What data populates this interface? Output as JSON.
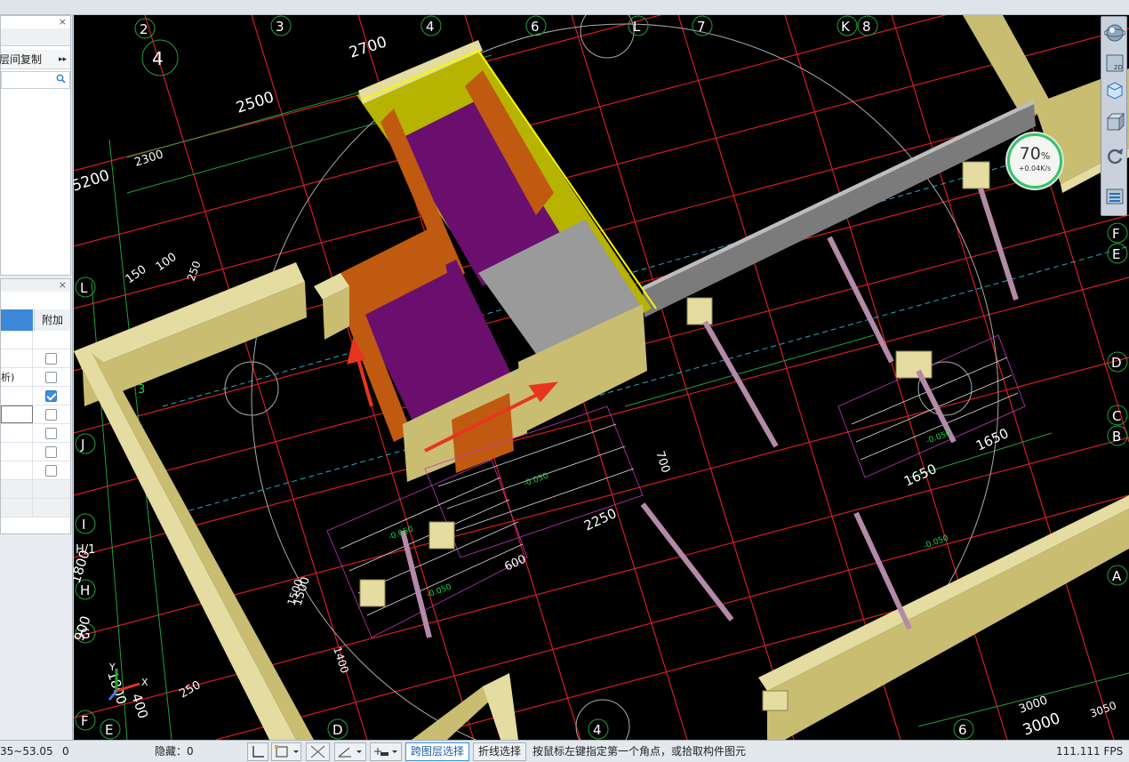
{
  "left_panel_top": {
    "close_label": "×",
    "toolbar_label": "层间复制",
    "more_label": "▸▸"
  },
  "left_panel_bottom": {
    "close_label": "×",
    "column_header": "附加",
    "rows": [
      {
        "label": "",
        "checked": false
      },
      {
        "label": "析)",
        "checked": false
      },
      {
        "label": "",
        "checked": true
      },
      {
        "label": "",
        "checked": false
      },
      {
        "label": "",
        "checked": false
      },
      {
        "label": "",
        "checked": false
      },
      {
        "label": "",
        "checked": false
      }
    ]
  },
  "speed_badge": {
    "percent": "70",
    "percent_unit": "%",
    "rate": "+0.04K/s"
  },
  "view_toolbar": {
    "icons": [
      "sphere-view-icon",
      "2d-view-icon",
      "3d-cube-icon",
      "box-view-icon",
      "rotate-icon",
      "layers-icon"
    ],
    "label_2d": "2D"
  },
  "cad": {
    "grid_labels": [
      {
        "t": "2",
        "kind": "circle"
      },
      {
        "t": "3",
        "kind": "circle"
      },
      {
        "t": "4",
        "kind": "circle"
      },
      {
        "t": "6",
        "kind": "circle"
      },
      {
        "t": "L",
        "kind": "circle"
      },
      {
        "t": "7",
        "kind": "circle"
      },
      {
        "t": "K",
        "kind": "circle"
      },
      {
        "t": "8",
        "kind": "circle"
      },
      {
        "t": "4",
        "kind": "circle"
      },
      {
        "t": "L",
        "kind": "circle"
      },
      {
        "t": "J",
        "kind": "circle"
      },
      {
        "t": "I",
        "kind": "circle"
      },
      {
        "t": "H/1",
        "kind": "plain"
      },
      {
        "t": "H",
        "kind": "circle"
      },
      {
        "t": "G",
        "kind": "circle"
      },
      {
        "t": "F",
        "kind": "circle"
      },
      {
        "t": "E",
        "kind": "circle"
      },
      {
        "t": "D",
        "kind": "circle"
      },
      {
        "t": "4",
        "kind": "circle"
      },
      {
        "t": "6",
        "kind": "circle"
      },
      {
        "t": "F",
        "kind": "circle"
      },
      {
        "t": "E",
        "kind": "circle"
      },
      {
        "t": "D",
        "kind": "circle"
      },
      {
        "t": "C",
        "kind": "circle"
      },
      {
        "t": "B",
        "kind": "circle"
      },
      {
        "t": "A",
        "kind": "circle"
      }
    ],
    "dimensions": [
      "2700",
      "2500",
      "5200",
      "2300",
      "150",
      "100",
      "250",
      "3",
      "1800",
      "1500",
      "900",
      "1800",
      "400",
      "250",
      "1500",
      "1400",
      "600",
      "2250",
      "700",
      "1650",
      "1650",
      "3000",
      "3000",
      "3050"
    ],
    "axis_x_label": "X",
    "axis_y_label": "Y",
    "level_marks": [
      "-0.050",
      "-0.050",
      "-0.050",
      "-0.050",
      "-0.050"
    ]
  },
  "statusbar": {
    "coords": "35~53.05",
    "zero": "0",
    "hidden": "隐藏：0",
    "cross_layer_select": "跨图层选择",
    "polyline_select": "折线选择",
    "hint": "按鼠标左键指定第一个角点，或拾取构件图元",
    "fps": "111.111 FPS"
  },
  "colors": {
    "wall": "#c9bd72",
    "wall_top": "#e4dca0",
    "wall_dark": "#8c8244",
    "purple": "#6a0f6e",
    "yellow": "#b6b400",
    "orange": "#c05a10",
    "grid_red": "#d61e1e",
    "grid_green": "#1fa23a",
    "arrow": "#e8351e"
  }
}
